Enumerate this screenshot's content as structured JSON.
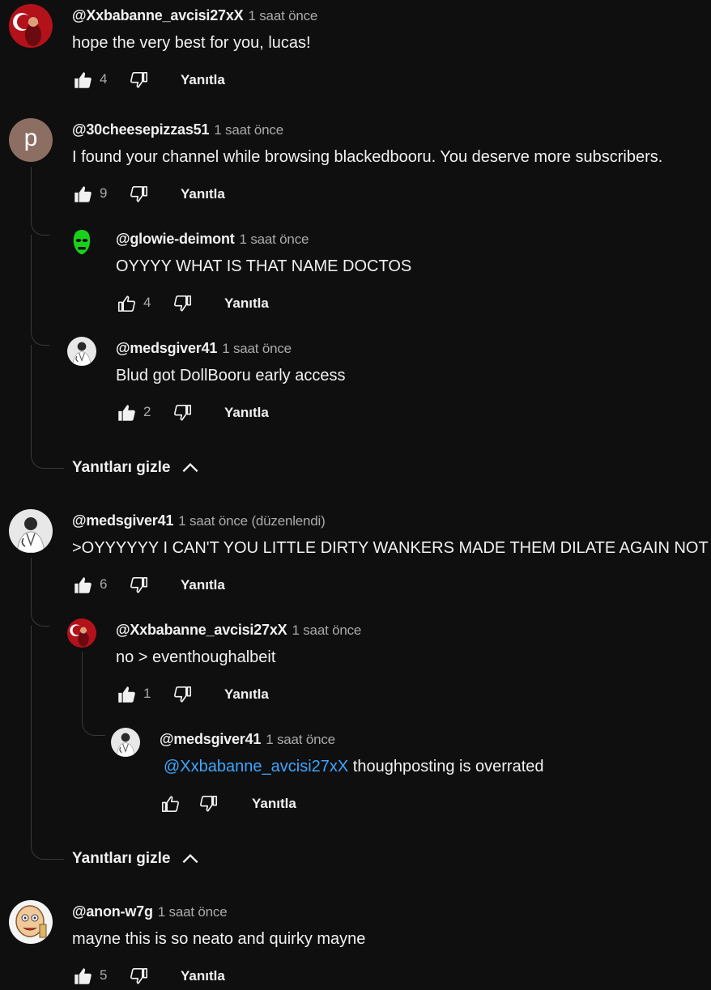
{
  "comments": [
    {
      "author": "@Xxbabanne_avcisi27xX",
      "time": "1 saat önce",
      "text": "hope the very best for you, lucas!",
      "likes": "4",
      "reply": "Yanıtla",
      "avatar_icon": "turkish-flag-avatar"
    },
    {
      "author": "@30cheesepizzas51",
      "time": "1 saat önce",
      "text": "I found your channel while browsing blackedbooru. You deserve more subscribers.",
      "likes": "9",
      "reply": "Yanıtla",
      "avatar_letter": "p",
      "avatar_color": "#8d6e63",
      "replies": [
        {
          "author": "@glowie-deimont",
          "time": "1 saat önce",
          "text": "OYYYY WHAT IS THAT NAME DOCTOS",
          "likes": "4",
          "reply": "Yanıtla",
          "avatar_icon": "green-mask-avatar"
        },
        {
          "author": "@medsgiver41",
          "time": "1 saat önce",
          "text": "Blud got DollBooru early access",
          "likes": "2",
          "reply": "Yanıtla",
          "avatar_icon": "doctor-avatar"
        }
      ],
      "hide_replies": "Yanıtları gizle"
    },
    {
      "author": "@medsgiver41",
      "time": "1 saat önce (düzenlendi)",
      "text": ">OYYYYYY I CAN'T YOU LITTLE DIRTY WANKERS MADE THEM DILATE AGAIN NOT LI",
      "likes": "6",
      "reply": "Yanıtla",
      "avatar_icon": "doctor-avatar",
      "replies": [
        {
          "author": "@Xxbabanne_avcisi27xX",
          "time": "1 saat önce",
          "text": "no > eventhoughalbeit",
          "likes": "1",
          "reply": "Yanıtla",
          "avatar_icon": "turkish-flag-avatar",
          "replies": [
            {
              "author": "@medsgiver41",
              "time": "1 saat önce",
              "mention": "@Xxbabanne_avcisi27xX",
              "text": " thoughposting is overrated",
              "likes": "",
              "reply": "Yanıtla",
              "avatar_icon": "doctor-avatar"
            }
          ]
        }
      ],
      "hide_replies": "Yanıtları gizle"
    },
    {
      "author": "@anon-w7g",
      "time": "1 saat önce",
      "text": "mayne this is so neato and quirky mayne",
      "likes": "5",
      "reply": "Yanıtla",
      "avatar_icon": "cartoon-face-avatar"
    }
  ],
  "colors": {
    "background": "#0f0f0f",
    "text": "#f1f1f1",
    "secondary": "#aaaaaa",
    "mention": "#3ea6ff"
  }
}
